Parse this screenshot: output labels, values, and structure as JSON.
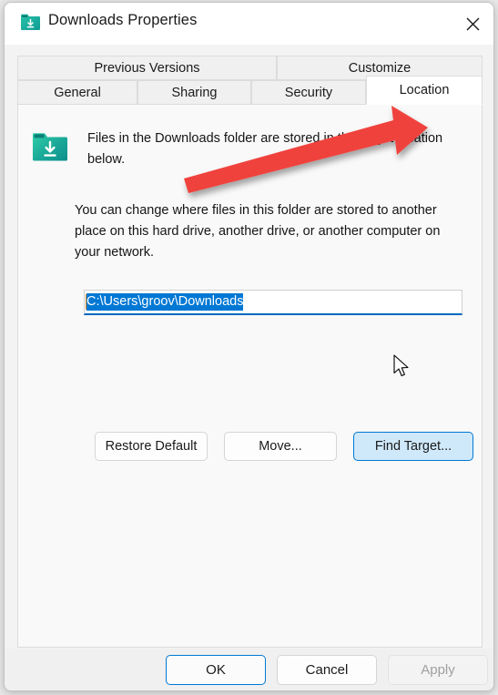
{
  "window": {
    "title": "Downloads Properties",
    "icon": "downloads-folder-icon",
    "close_label": "✕"
  },
  "tabs": {
    "row1": [
      {
        "label": "Previous Versions",
        "selected": false
      },
      {
        "label": "Customize",
        "selected": false
      }
    ],
    "row2": [
      {
        "label": "General",
        "selected": false
      },
      {
        "label": "Sharing",
        "selected": false
      },
      {
        "label": "Security",
        "selected": false
      },
      {
        "label": "Location",
        "selected": true
      }
    ]
  },
  "location_tab": {
    "folder_description": "Files in the Downloads folder are stored in the target location below.",
    "change_description": "You can change where files in this folder are stored to another place on this hard drive, another drive, or another computer on your network.",
    "path_input": {
      "value": "C:\\Users\\groov\\Downloads",
      "placeholder": "",
      "selected": true,
      "focused": true
    },
    "buttons": [
      {
        "name": "restore-default",
        "label": "Restore Default",
        "state": "normal"
      },
      {
        "name": "move",
        "label": "Move...",
        "state": "normal"
      },
      {
        "name": "find-target",
        "label": "Find Target...",
        "state": "highlighted"
      }
    ]
  },
  "footer": {
    "ok_label": "OK",
    "cancel_label": "Cancel",
    "apply_label": "Apply",
    "apply_disabled": true
  },
  "annotation": {
    "type": "red-arrow",
    "points_to": "Location",
    "color": "#f0423c"
  },
  "colors": {
    "accent": "#0078d4",
    "selection": "#0078d4",
    "annotation_red": "#f0423c",
    "folder_teal": "#17a398",
    "panel_bg": "#f9f9f9",
    "window_bg": "#f3f3f3",
    "titlebar_bg": "#ffffff",
    "disabled_text": "#a0a0a0"
  }
}
